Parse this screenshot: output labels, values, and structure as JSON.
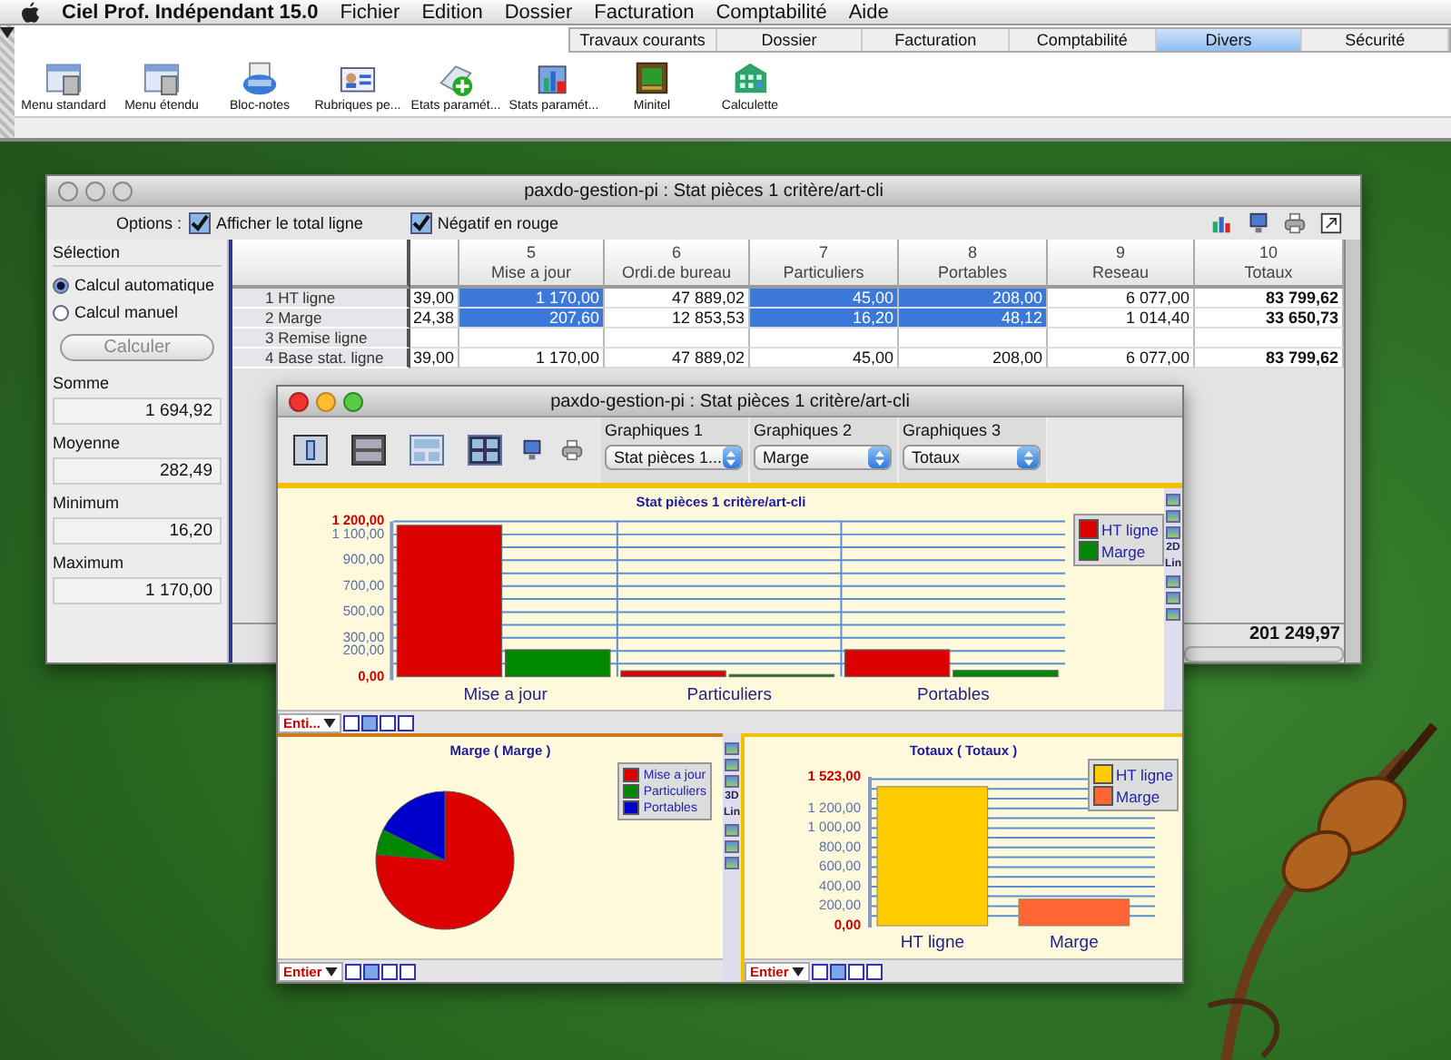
{
  "menu_bar": {
    "app_name": "Ciel Prof. Indépendant 15.0",
    "menus": [
      "Fichier",
      "Edition",
      "Dossier",
      "Facturation",
      "Comptabilité",
      "Aide"
    ]
  },
  "toolbar": {
    "tabs": [
      {
        "label": "Travaux courants",
        "selected": false
      },
      {
        "label": "Dossier",
        "selected": false
      },
      {
        "label": "Facturation",
        "selected": false
      },
      {
        "label": "Comptabilité",
        "selected": false
      },
      {
        "label": "Divers",
        "selected": true
      },
      {
        "label": "Sécurité",
        "selected": false
      }
    ],
    "items": [
      "Menu standard",
      "Menu étendu",
      "Bloc-notes",
      "Rubriques pe...",
      "Etats paramét...",
      "Stats paramét...",
      "Minitel",
      "Calculette"
    ]
  },
  "stats_window": {
    "title": "paxdo-gestion-pi : Stat pièces 1 critère/art-cli",
    "options_label": "Options :",
    "options": [
      {
        "label": "Afficher le total ligne",
        "checked": true
      },
      {
        "label": "Négatif en rouge",
        "checked": true
      }
    ],
    "selection": {
      "title": "Sélection",
      "modes": [
        {
          "label": "Calcul automatique",
          "selected": true
        },
        {
          "label": "Calcul manuel",
          "selected": false
        }
      ],
      "button": {
        "label": "Calculer",
        "disabled": true
      },
      "stats": [
        {
          "label": "Somme",
          "value": "1 694,92"
        },
        {
          "label": "Moyenne",
          "value": "282,49"
        },
        {
          "label": "Minimum",
          "value": "16,20"
        },
        {
          "label": "Maximum",
          "value": "1 170,00"
        }
      ]
    },
    "table": {
      "columns": [
        {
          "kind": "value"
        },
        {
          "kind": "value",
          "number": "5",
          "name": "Mise a jour"
        },
        {
          "kind": "value",
          "number": "6",
          "name": "Ordi.de bureau"
        },
        {
          "kind": "value",
          "number": "7",
          "name": "Particuliers"
        },
        {
          "kind": "value",
          "number": "8",
          "name": "Portables"
        },
        {
          "kind": "value",
          "number": "9",
          "name": "Reseau"
        },
        {
          "kind": "total",
          "number": "10",
          "name": "Totaux"
        }
      ],
      "rows": [
        {
          "label": "1 HT ligne",
          "cells": [
            {
              "text": "39,00",
              "selected": false
            },
            {
              "text": "1 170,00",
              "selected": true
            },
            {
              "text": "47 889,02",
              "selected": false
            },
            {
              "text": "45,00",
              "selected": true
            },
            {
              "text": "208,00",
              "selected": true
            },
            {
              "text": "6 077,00",
              "selected": false
            },
            {
              "text": "83 799,62",
              "selected": false
            }
          ]
        },
        {
          "label": "2 Marge",
          "cells": [
            {
              "text": "24,38",
              "selected": false
            },
            {
              "text": "207,60",
              "selected": true
            },
            {
              "text": "12 853,53",
              "selected": false
            },
            {
              "text": "16,20",
              "selected": true
            },
            {
              "text": "48,12",
              "selected": true
            },
            {
              "text": "1 014,40",
              "selected": false
            },
            {
              "text": "33 650,73",
              "selected": false
            }
          ]
        },
        {
          "label": "3 Remise ligne"
        },
        {
          "label": "4 Base stat. ligne",
          "cells": [
            {
              "text": "39,00",
              "selected": false
            },
            {
              "text": "1 170,00",
              "selected": false
            },
            {
              "text": "47 889,02",
              "selected": false
            },
            {
              "text": "45,00",
              "selected": false
            },
            {
              "text": "208,00",
              "selected": false
            },
            {
              "text": "6 077,00",
              "selected": false
            },
            {
              "text": "83 799,62",
              "selected": false
            }
          ]
        }
      ]
    },
    "grand_total": "201 249,97"
  },
  "chart_window": {
    "title": "paxdo-gestion-pi : Stat pièces 1 critère/art-cli",
    "graph_selectors": [
      {
        "label": "Graphiques 1",
        "value": "Stat pièces 1..."
      },
      {
        "label": "Graphiques 2",
        "value": "Marge"
      },
      {
        "label": "Graphiques 3",
        "value": "Totaux"
      }
    ],
    "main_chart": {
      "format": "Enti...",
      "tool_labels": [
        "2D",
        "Lin"
      ],
      "chart_data": {
        "type": "bar",
        "title": "Stat pièces 1 critère/art-cli",
        "legend": "right",
        "grid": true,
        "categories": [
          "Mise a jour",
          "Particuliers",
          "Portables"
        ],
        "series": [
          {
            "name": "HT ligne",
            "color": "#dd0000",
            "values": [
              1170.0,
              45.0,
              208.0
            ]
          },
          {
            "name": "Marge",
            "color": "#008800",
            "values": [
              208,
              16,
              48
            ]
          }
        ],
        "ylim": [
          0,
          1200
        ],
        "yticks": [
          {
            "value": 0,
            "label": "0,00"
          },
          {
            "value": 200,
            "label": "200,00"
          },
          {
            "value": 300,
            "label": "300,00"
          },
          {
            "value": 500,
            "label": "500,00"
          },
          {
            "value": 700,
            "label": "700,00"
          },
          {
            "value": 900,
            "label": "900,00"
          },
          {
            "value": 1100,
            "label": "1 100,00"
          },
          {
            "value": 1200,
            "label": "1 200,00"
          }
        ]
      }
    },
    "pie_chart": {
      "format": "Entier",
      "tool_labels": [
        "3D",
        "Lin"
      ],
      "chart_data": {
        "type": "pie",
        "title": "Marge ( Marge )",
        "legend": "upper right",
        "categories": [
          "Mise a jour",
          "Particuliers",
          "Portables"
        ],
        "values": [
          76.35,
          5.96,
          17.69
        ]
      }
    },
    "totals_chart": {
      "format": "Entier",
      "chart_data": {
        "type": "bar",
        "title": "Totaux ( Totaux )",
        "legend": "upper right",
        "grid": true,
        "categories": [
          "HT ligne",
          "Marge"
        ],
        "series": [
          {
            "name": "HT ligne",
            "color": "#ffcc00",
            "values": [
              1423,
              null
            ]
          },
          {
            "name": "Marge",
            "color": "#ff6633",
            "values": [
              null,
              272
            ]
          }
        ],
        "ylim": [
          0,
          1523
        ],
        "yticks": [
          {
            "value": 0,
            "label": "0,00"
          },
          {
            "value": 200,
            "label": "200,00"
          },
          {
            "value": 400,
            "label": "400,00"
          },
          {
            "value": 600,
            "label": "600,00"
          },
          {
            "value": 800,
            "label": "800,00"
          },
          {
            "value": 1000,
            "label": "1 000,00"
          },
          {
            "value": 1200,
            "label": "1 200,00"
          },
          {
            "value": 1523,
            "label": "1 523,00"
          }
        ]
      }
    }
  }
}
